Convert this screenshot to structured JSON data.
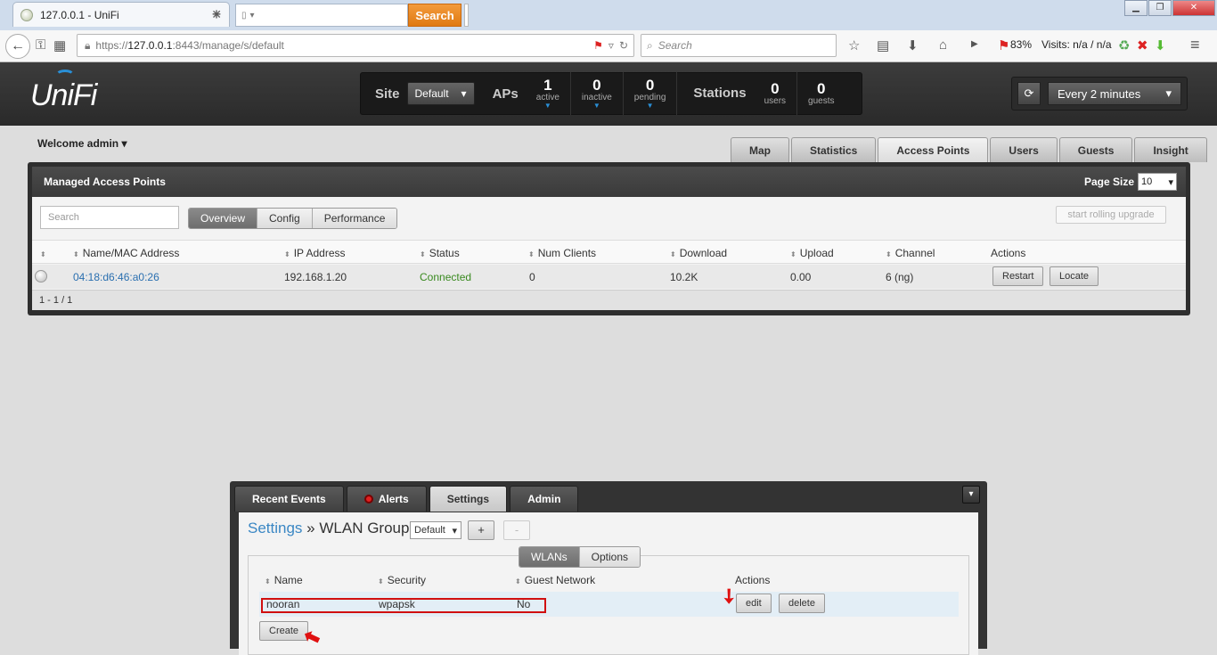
{
  "browser": {
    "tab_title": "127.0.0.1 - UniFi",
    "search_button": "Search",
    "url_prefix": "https://",
    "url_host": "127.0.0.1",
    "url_rest": ":8443/manage/s/default",
    "search_placeholder": "Search",
    "battery": "83%",
    "visits": "Visits: n/a / n/a"
  },
  "header": {
    "logo": "UniFi",
    "site_label": "Site",
    "site_value": "Default",
    "aps_label": "APs",
    "stats": [
      {
        "value": "1",
        "label": "active"
      },
      {
        "value": "0",
        "label": "inactive"
      },
      {
        "value": "0",
        "label": "pending"
      }
    ],
    "stations_label": "Stations",
    "stations": [
      {
        "value": "0",
        "label": "users"
      },
      {
        "value": "0",
        "label": "guests"
      }
    ],
    "refresh_value": "Every 2 minutes"
  },
  "welcome": "Welcome admin",
  "main_tabs": [
    "Map",
    "Statistics",
    "Access Points",
    "Users",
    "Guests",
    "Insight"
  ],
  "ap_panel": {
    "title": "Managed Access Points",
    "page_size_label": "Page Size",
    "page_size_value": "10",
    "search_placeholder": "Search",
    "view_tabs": [
      "Overview",
      "Config",
      "Performance"
    ],
    "upgrade_button": "start rolling upgrade",
    "columns": [
      "Name/MAC Address",
      "IP Address",
      "Status",
      "Num Clients",
      "Download",
      "Upload",
      "Channel",
      "Actions"
    ],
    "rows": [
      {
        "name": "04:18:d6:46:a0:26",
        "ip": "192.168.1.20",
        "status": "Connected",
        "clients": "0",
        "download": "10.2K",
        "upload": "0.00",
        "channel": "6 (ng)"
      }
    ],
    "restart_button": "Restart",
    "locate_button": "Locate",
    "footer": "1 - 1 / 1"
  },
  "bottom": {
    "tabs": [
      "Recent Events",
      "Alerts",
      "Settings",
      "Admin"
    ],
    "crumb_link": "Settings",
    "crumb_sep": "»",
    "crumb_current": "WLAN Group",
    "group_value": "Default",
    "add_button": "+",
    "remove_button": "-",
    "sub_tabs": [
      "WLANs",
      "Options"
    ],
    "columns": [
      "Name",
      "Security",
      "Guest Network",
      "Actions"
    ],
    "rows": [
      {
        "name": "nooran",
        "security": "wpapsk",
        "guest": "No"
      }
    ],
    "edit_button": "edit",
    "delete_button": "delete",
    "create_button": "Create"
  }
}
